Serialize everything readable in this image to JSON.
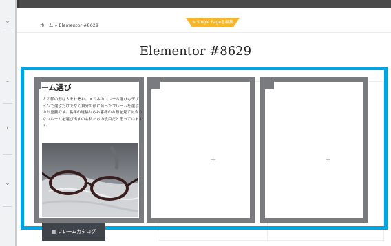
{
  "header": {
    "breadcrumb": "ホーム » Elementor #8629",
    "single_page_tab": "✎ Single Pageを編集"
  },
  "main": {
    "page_title": "Elementor #8629",
    "column1": {
      "title": "ーム選び",
      "body": "人の顔の形は人それぞれ。メガネのフレーム選びもデザ\nインで選ぶだけでなく自分の顔に合ったフレームを選ぶ\nのが重要です。長年の経験からお客様のお顔を見て似合う\nなフレームを選び出すのも私たちの役目だと思っています\nす。",
      "button_label": "フレームカタログ",
      "button_icon": "grid-icon"
    },
    "column2": {
      "add_label": "+"
    },
    "column3": {
      "add_label": "+"
    }
  },
  "left_panel": {
    "icons": [
      "chevron-down-icon",
      "minus-icon",
      "chevron-right-icon",
      "chevron-down-icon"
    ],
    "icon_glyphs": [
      "⌄",
      "–",
      "›",
      "⌄"
    ]
  },
  "colors": {
    "section_border": "#00a6e4",
    "column_border": "#7a7b7e",
    "tab": "#f7b52b"
  }
}
